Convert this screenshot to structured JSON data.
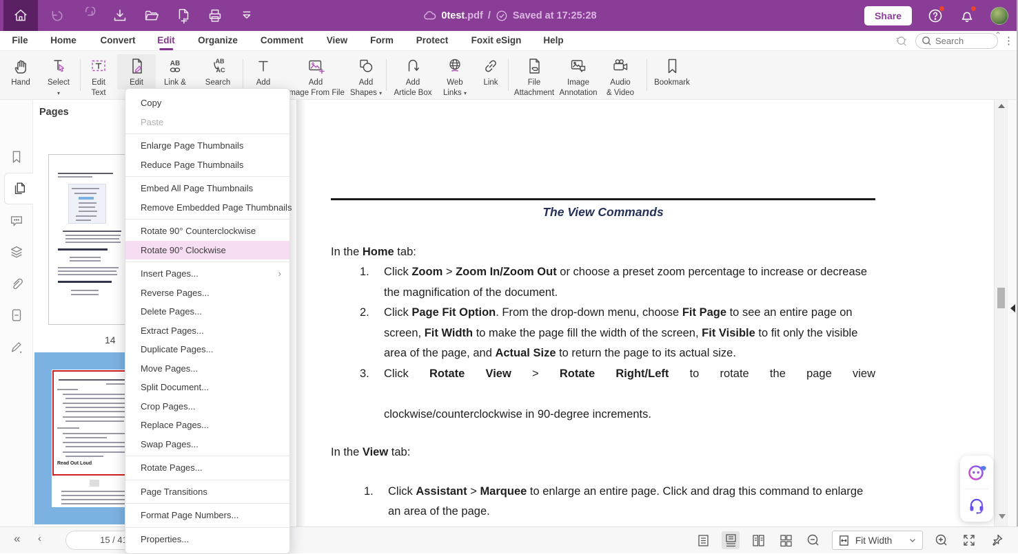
{
  "titlebar": {
    "doc_name": "0test",
    "doc_ext": ".pdf",
    "path_sep": "/",
    "saved_status": "Saved at 17:25:28",
    "share_label": "Share"
  },
  "menubar": {
    "items": [
      "File",
      "Home",
      "Convert",
      "Edit",
      "Organize",
      "Comment",
      "View",
      "Form",
      "Protect",
      "Foxit eSign",
      "Help"
    ],
    "active_item": "Edit",
    "search_placeholder": "Search"
  },
  "toolbar": {
    "items": [
      {
        "line1": "Hand",
        "line2": ""
      },
      {
        "line1": "Select",
        "line2": ""
      },
      {
        "line1": "Edit",
        "line2": "Text"
      },
      {
        "line1": "Edit",
        "line2": ""
      },
      {
        "line1": "Link &",
        "line2": ""
      },
      {
        "line1": "Search",
        "line2": ""
      },
      {
        "line1": "Add",
        "line2": ""
      },
      {
        "line1": "Add",
        "line2": "Image From File"
      },
      {
        "line1": "Add",
        "line2": "Shapes"
      },
      {
        "line1": "Add",
        "line2": "Article Box"
      },
      {
        "line1": "Web",
        "line2": "Links"
      },
      {
        "line1": "Link",
        "line2": ""
      },
      {
        "line1": "File",
        "line2": "Attachment"
      },
      {
        "line1": "Image",
        "line2": "Annotation"
      },
      {
        "line1": "Audio",
        "line2": "& Video"
      },
      {
        "line1": "Bookmark",
        "line2": ""
      }
    ]
  },
  "pages_panel": {
    "header": "Pages",
    "page14_label": "14",
    "thumb15_heading": "Read Out Loud"
  },
  "context_menu": {
    "items": [
      {
        "label": "Copy"
      },
      {
        "label": "Paste"
      },
      {
        "label": "Enlarge Page Thumbnails"
      },
      {
        "label": "Reduce Page Thumbnails"
      },
      {
        "label": "Embed All Page Thumbnails"
      },
      {
        "label": "Remove Embedded Page Thumbnails"
      },
      {
        "label": "Rotate 90° Counterclockwise"
      },
      {
        "label": "Rotate 90° Clockwise"
      },
      {
        "label": "Insert Pages..."
      },
      {
        "label": "Reverse Pages..."
      },
      {
        "label": "Delete Pages..."
      },
      {
        "label": "Extract Pages..."
      },
      {
        "label": "Duplicate Pages..."
      },
      {
        "label": "Move Pages..."
      },
      {
        "label": "Split Document..."
      },
      {
        "label": "Crop Pages..."
      },
      {
        "label": "Replace Pages..."
      },
      {
        "label": "Swap Pages..."
      },
      {
        "label": "Rotate Pages..."
      },
      {
        "label": "Page Transitions"
      },
      {
        "label": "Format Page Numbers..."
      },
      {
        "label": "Properties..."
      }
    ],
    "highlighted_item": "Rotate 90° Clockwise",
    "disabled_item": "Paste"
  },
  "document": {
    "title": "The View Commands",
    "intro1": {
      "r0": "In the ",
      "r1": "Home",
      "r2": " tab:"
    },
    "item1": {
      "num": "1.",
      "r0": "Click ",
      "r1": "Zoom",
      "r2": " > ",
      "r3": "Zoom In/Zoom Out",
      "r4": " or choose a preset zoom percentage to increase or decrease the magnification of the document."
    },
    "item2": {
      "num": "2.",
      "r0": "Click ",
      "r1": "Page Fit Option",
      "r2": ". From the drop-down menu, choose ",
      "r3": "Fit Page",
      "r4": " to see an entire page on screen, ",
      "r5": "Fit Width",
      "r6": " to make the page fill the width of the screen, ",
      "r7": "Fit Visible",
      "r8": " to fit only the visible area of the page, and ",
      "r9": "Actual Size",
      "r10": " to return the page to its actual size."
    },
    "item3": {
      "num": "3.",
      "r0": "Click ",
      "r1": "Rotate View",
      "r2": " > ",
      "r3": "Rotate Right/Left",
      "r4": " to rotate the page view",
      "r5": "clockwise/counterclockwise in 90-degree increments."
    },
    "intro2": {
      "r0": "In the ",
      "r1": "View",
      "r2": " tab:"
    },
    "item4": {
      "num": "1.",
      "r0": "Click ",
      "r1": "Assistant",
      "r2": " > ",
      "r3": "Marquee",
      "r4": " to enlarge an entire page. Click and drag this command to enlarge an area of the page."
    }
  },
  "statusbar": {
    "page_display": "15 / 41",
    "fit_mode": "Fit Width"
  },
  "colors": {
    "titlebar_purple": "#8a3d96",
    "home_btn_purple": "#5b2064",
    "active_menu_purple": "#82358c",
    "menu_highlight_pink": "#f6ddf1",
    "thumb_select_blue": "#7cb2e2",
    "view_box_red": "#cf1f1f",
    "doc_title_navy": "#253057"
  }
}
